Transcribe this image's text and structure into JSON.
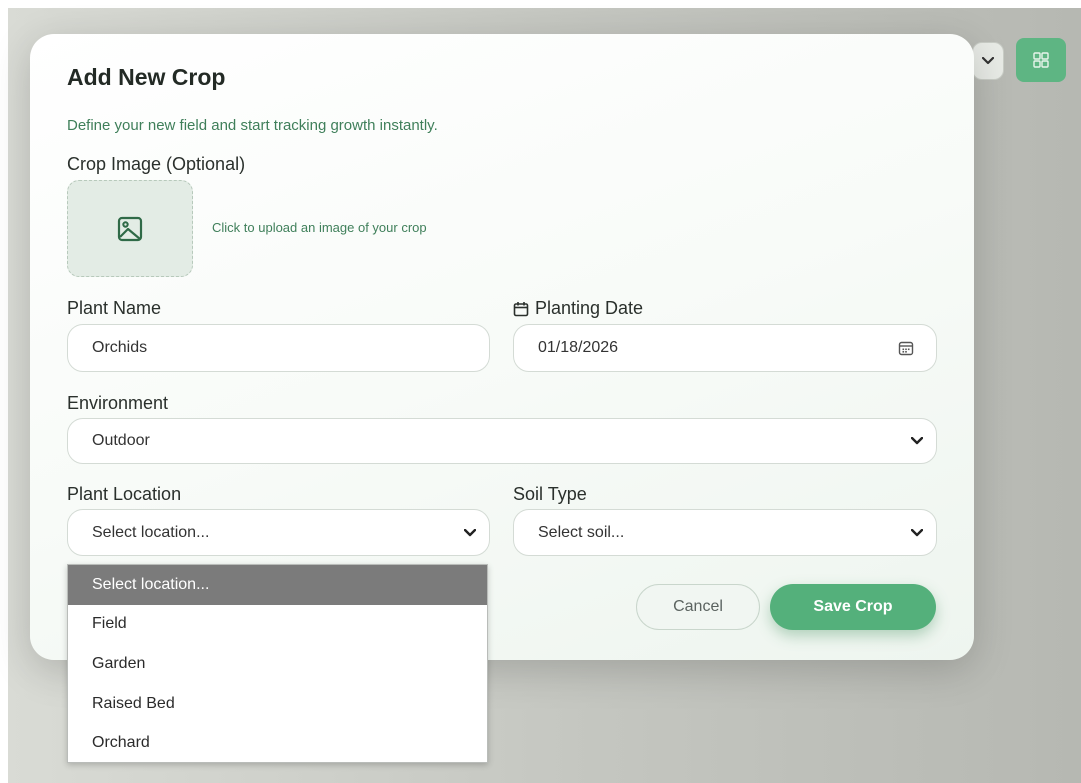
{
  "background": {
    "grid_button_icon": "grid-icon",
    "accent_color": "#5eb583"
  },
  "modal": {
    "title": "Add New Crop",
    "subtitle": "Define your new field and start tracking growth instantly.",
    "image_upload": {
      "label": "Crop Image (Optional)",
      "hint": "Click to upload an image of your crop",
      "icon": "image-icon"
    },
    "plant_name": {
      "label": "Plant Name",
      "value": "Orchids"
    },
    "planting_date": {
      "label": "Planting Date",
      "value": "01/18/2026",
      "label_icon": "calendar-icon",
      "field_icon": "calendar-icon"
    },
    "environment": {
      "label": "Environment",
      "value": "Outdoor"
    },
    "plant_location": {
      "label": "Plant Location",
      "value": "Select location...",
      "options": [
        "Select location...",
        "Field",
        "Garden",
        "Raised Bed",
        "Orchard"
      ],
      "selected_index": 0
    },
    "soil_type": {
      "label": "Soil Type",
      "value": "Select soil..."
    },
    "buttons": {
      "cancel": "Cancel",
      "save": "Save Crop"
    }
  },
  "colors": {
    "primary_green": "#54b07b",
    "subtitle_green": "#3f7f5a",
    "dropdown_selected_bg": "#7b7b7b"
  }
}
